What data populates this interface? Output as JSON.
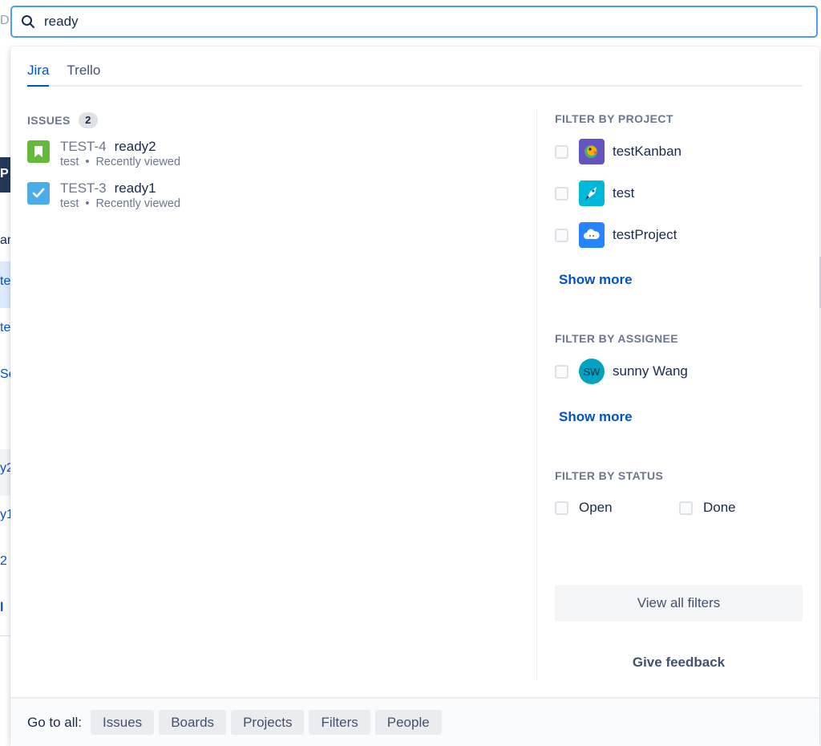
{
  "search": {
    "value": "ready"
  },
  "tabs": [
    {
      "label": "Jira",
      "active": true
    },
    {
      "label": "Trello",
      "active": false
    }
  ],
  "issues": {
    "heading": "ISSUES",
    "count": "2",
    "items": [
      {
        "key": "TEST-4",
        "title": "ready2",
        "project": "test",
        "separator": "•",
        "meta": "Recently viewed",
        "icon": "bookmark-story-icon",
        "icon_color": "#63ba3c"
      },
      {
        "key": "TEST-3",
        "title": "ready1",
        "project": "test",
        "separator": "•",
        "meta": "Recently viewed",
        "icon": "checkbox-task-icon",
        "icon_color": "#4bade8"
      }
    ]
  },
  "filters": {
    "project": {
      "heading": "FILTER BY PROJECT",
      "items": [
        {
          "label": "testKanban",
          "icon": "parrot-avatar-icon"
        },
        {
          "label": "test",
          "icon": "rocket-avatar-icon"
        },
        {
          "label": "testProject",
          "icon": "cloud-avatar-icon"
        }
      ],
      "show_more": "Show more"
    },
    "assignee": {
      "heading": "FILTER BY ASSIGNEE",
      "items": [
        {
          "label": "sunny Wang",
          "initials": "SW"
        }
      ],
      "show_more": "Show more"
    },
    "status": {
      "heading": "FILTER BY STATUS",
      "items": [
        {
          "label": "Open"
        },
        {
          "label": "Done"
        }
      ]
    },
    "view_all": "View all filters",
    "feedback": "Give feedback"
  },
  "footer": {
    "label": "Go to all:",
    "chips": [
      "Issues",
      "Boards",
      "Projects",
      "Filters",
      "People"
    ]
  },
  "background": {
    "fragments": [
      "D",
      "P",
      "am",
      "te",
      "te",
      "Se",
      "y2",
      "y1",
      "2",
      "l"
    ]
  },
  "colors": {
    "accent": "#0052cc",
    "focus_ring": "#4c9aff",
    "assignee_avatar": "#00a3bf"
  }
}
